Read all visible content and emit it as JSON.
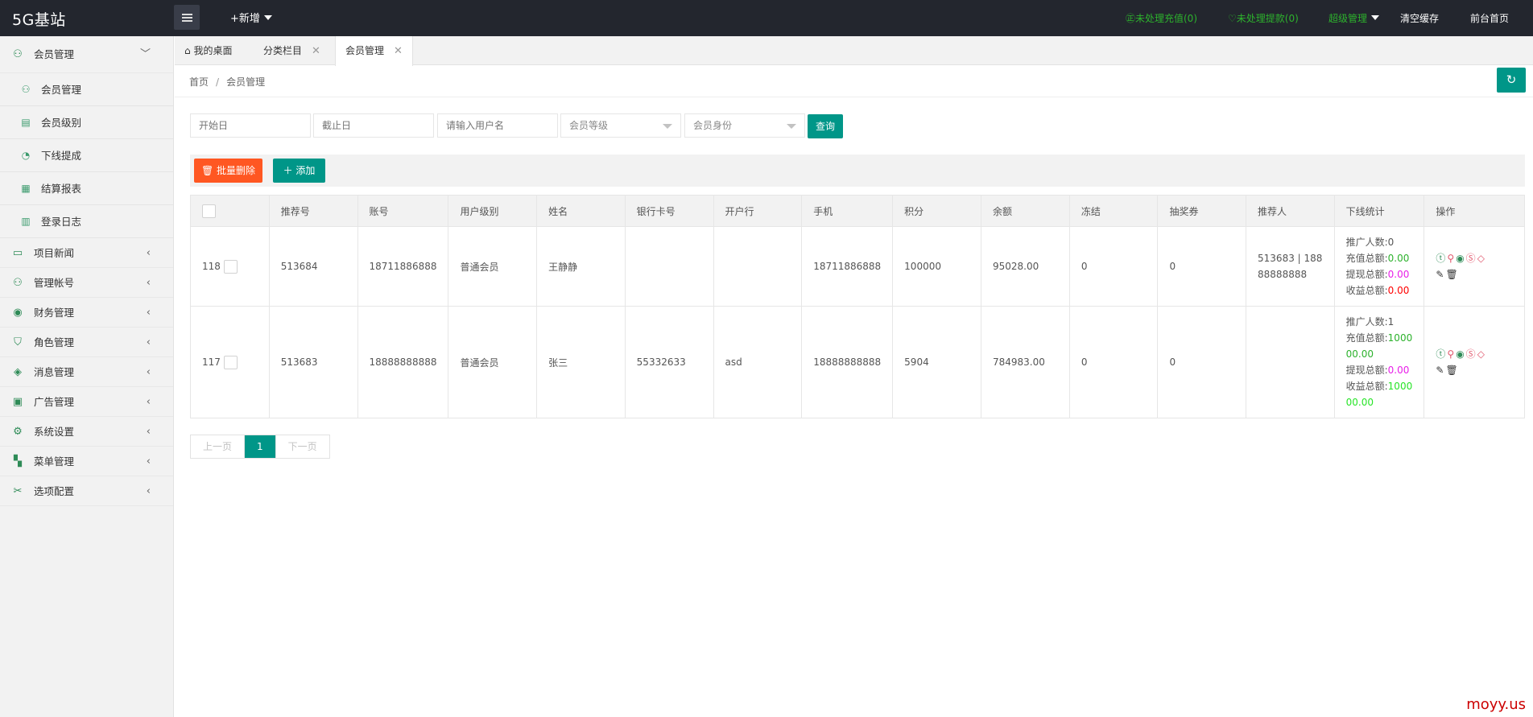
{
  "header": {
    "logo": "5G基站",
    "new_label": "+新增",
    "pending_recharge": "㊣未处理充值(0)",
    "pending_withdraw": "♡未处理提款(0)",
    "super_admin": "超级管理",
    "clear_cache": "清空缓存",
    "front_home": "前台首页"
  },
  "sidebar": {
    "top": {
      "label": "会员管理",
      "icon": "user-icon"
    },
    "sub_items": [
      {
        "label": "会员管理",
        "icon": "user-icon"
      },
      {
        "label": "会员级别",
        "icon": "level-icon"
      },
      {
        "label": "下线提成",
        "icon": "gauge-icon"
      },
      {
        "label": "结算报表",
        "icon": "report-icon"
      },
      {
        "label": "登录日志",
        "icon": "calendar-icon"
      }
    ],
    "items": [
      {
        "label": "项目新闻",
        "icon": "book-icon"
      },
      {
        "label": "管理帐号",
        "icon": "admin-icon"
      },
      {
        "label": "财务管理",
        "icon": "finance-icon"
      },
      {
        "label": "角色管理",
        "icon": "shield-icon"
      },
      {
        "label": "消息管理",
        "icon": "message-icon"
      },
      {
        "label": "广告管理",
        "icon": "ad-icon"
      },
      {
        "label": "系统设置",
        "icon": "settings-icon"
      },
      {
        "label": "菜单管理",
        "icon": "menu-icon"
      },
      {
        "label": "选项配置",
        "icon": "config-icon"
      }
    ]
  },
  "tabs": [
    {
      "label": "我的桌面"
    },
    {
      "label": "分类栏目"
    },
    {
      "label": "会员管理"
    }
  ],
  "breadcrumb": {
    "home": "首页",
    "sep": "/",
    "current": "会员管理"
  },
  "filters": {
    "start_date": "开始日",
    "end_date": "截止日",
    "username": "请输入用户名",
    "level": "会员等级",
    "identity": "会员身份",
    "query": "查询"
  },
  "toolbar": {
    "batch_delete": "批量删除",
    "add": "添加"
  },
  "table": {
    "headers": [
      "",
      "推荐号",
      "账号",
      "用户级别",
      "姓名",
      "银行卡号",
      "开户行",
      "手机",
      "积分",
      "余额",
      "冻结",
      "抽奖券",
      "推荐人",
      "下线统计",
      "操作"
    ],
    "rows": [
      {
        "id": "118",
        "ref_no": "513684",
        "account": "18711886888",
        "level": "普通会员",
        "name": "王静静",
        "bank_card": "",
        "bank": "",
        "phone": "18711886888",
        "points": "100000",
        "balance": "95028.00",
        "frozen": "0",
        "tickets": "0",
        "referrer": "513683 | 18888888888",
        "stats": {
          "promote_label": "推广人数:",
          "promote": "0",
          "recharge_label": "充值总额:",
          "recharge": "0.00",
          "withdraw_label": "提现总额:",
          "withdraw": "0.00",
          "income_label": "收益总额:",
          "income": "0.00"
        }
      },
      {
        "id": "117",
        "ref_no": "513683",
        "account": "18888888888",
        "level": "普通会员",
        "name": "张三",
        "bank_card": "55332633",
        "bank": "asd",
        "phone": "18888888888",
        "points": "5904",
        "balance": "784983.00",
        "frozen": "0",
        "tickets": "0",
        "referrer": "",
        "stats": {
          "promote_label": "推广人数:",
          "promote": "1",
          "recharge_label": "充值总额:",
          "recharge": "100000.00",
          "withdraw_label": "提现总额:",
          "withdraw": "0.00",
          "income_label": "收益总额:",
          "income": "100000.00"
        }
      }
    ]
  },
  "pager": {
    "prev": "上一页",
    "current": "1",
    "next": "下一页"
  },
  "watermark": "moyy.us",
  "colors": {
    "accent": "#009688",
    "danger": "#ff5722",
    "header": "#23262e"
  }
}
